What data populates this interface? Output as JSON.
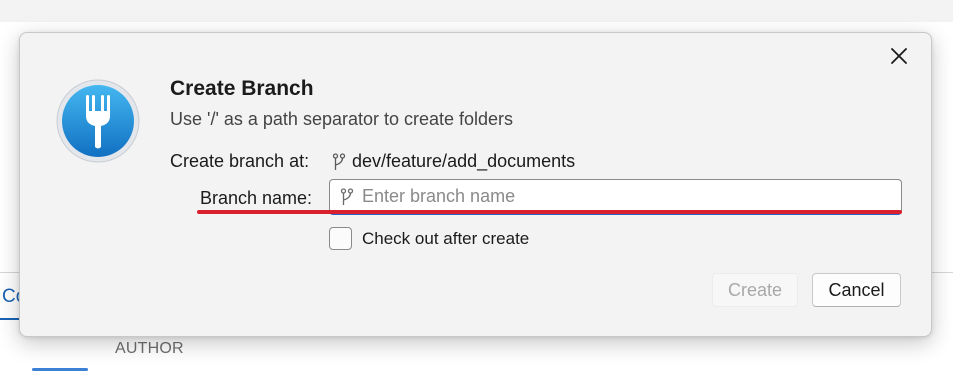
{
  "background": {
    "tab_label": "Co",
    "column_header": "AUTHOR"
  },
  "dialog": {
    "title": "Create Branch",
    "subtitle": "Use '/' as a path separator to create folders",
    "create_at_label": "Create branch at:",
    "create_at_value": "dev/feature/add_documents",
    "branch_name_label": "Branch name:",
    "branch_name_value": "",
    "branch_name_placeholder": "Enter branch name",
    "checkout_label": "Check out after create",
    "checkout_checked": false,
    "create_button": "Create",
    "create_enabled": false,
    "cancel_button": "Cancel",
    "icons": [
      "app-fork-logo",
      "branch-icon",
      "close-icon"
    ]
  },
  "colors": {
    "accent": "#2a62c9",
    "annotation": "#d9202e",
    "logo_blue": "#1e88d6"
  }
}
